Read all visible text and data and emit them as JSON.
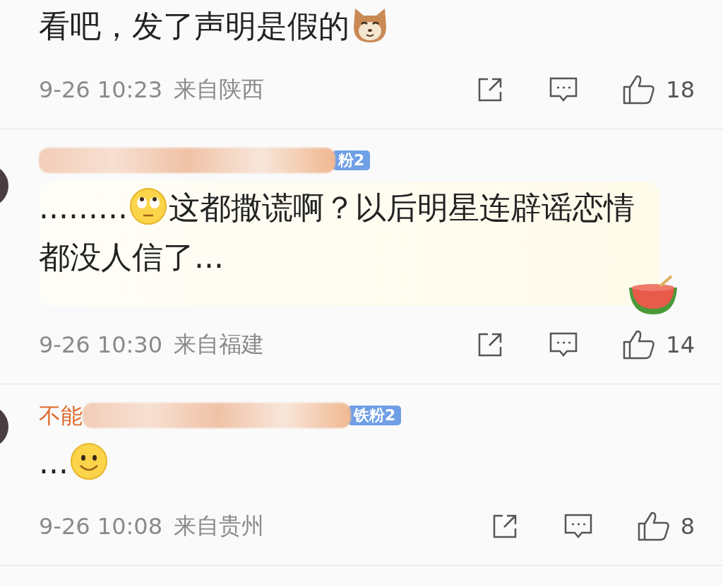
{
  "comments": [
    {
      "content": [
        {
          "kind": "text",
          "text": "看吧，发了声明是假的"
        },
        {
          "kind": "emoji"
        }
      ],
      "time": "9-26 10:23",
      "location": "来自陕西",
      "likes": "18"
    },
    {
      "avatar": true,
      "name_hidden": true,
      "badge": "粉2",
      "bubble": true,
      "content": [
        {
          "kind": "text",
          "text": "........."
        },
        {
          "kind": "emoji"
        },
        {
          "kind": "text",
          "text": "这都撒谎啊？以后明星连辟谣恋情都没人信了..."
        }
      ],
      "time": "9-26 10:30",
      "location": "来自福建",
      "likes": "14"
    },
    {
      "avatar": true,
      "name": "不能",
      "name_hidden": true,
      "badge": "铁粉2",
      "content": [
        {
          "kind": "text",
          "text": "..."
        },
        {
          "kind": "emoji"
        }
      ],
      "time": "9-26 10:08",
      "location": "来自贵州",
      "likes": "8"
    }
  ]
}
